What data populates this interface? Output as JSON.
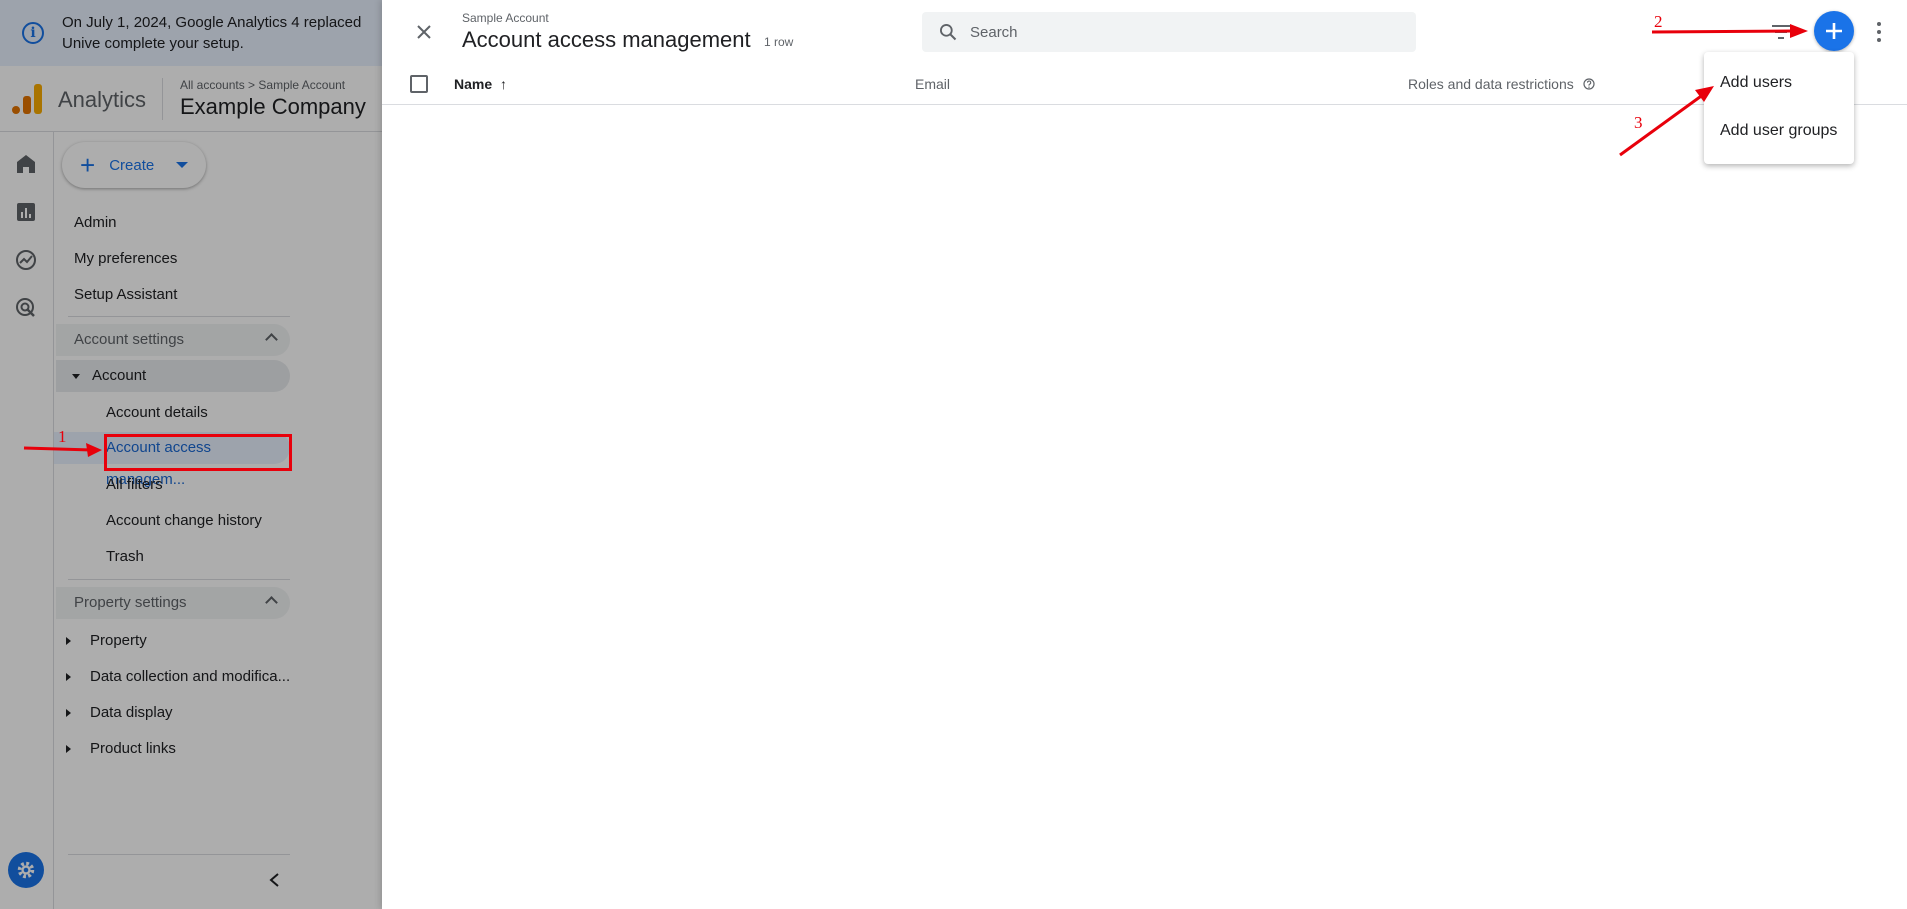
{
  "banner": {
    "text": "On July 1, 2024, Google Analytics 4 replaced Unive complete your setup."
  },
  "header": {
    "brand": "Analytics",
    "breadcrumb_root": "All accounts",
    "breadcrumb_separator": ">",
    "breadcrumb_account": "Sample Account",
    "account_name": "Example Company"
  },
  "sidebar": {
    "create_label": "Create",
    "items": {
      "admin": "Admin",
      "preferences": "My preferences",
      "setup": "Setup Assistant"
    },
    "account_settings": {
      "header": "Account settings",
      "group": "Account",
      "children": {
        "details": "Account details",
        "access": "Account access managem...",
        "filters": "All filters",
        "history": "Account change history",
        "trash": "Trash"
      }
    },
    "property_settings": {
      "header": "Property settings",
      "items": {
        "property": "Property",
        "data_collection": "Data collection and modifica...",
        "data_display": "Data display",
        "product_links": "Product links"
      }
    }
  },
  "sheet": {
    "eyebrow": "Sample Account",
    "title": "Account access management",
    "row_count": "1 row",
    "search_placeholder": "Search",
    "columns": {
      "name": "Name",
      "name_sort": "↑",
      "email": "Email",
      "roles": "Roles and data restrictions"
    }
  },
  "add_menu": {
    "add_users": "Add users",
    "add_user_groups": "Add user groups"
  },
  "annotations": {
    "step1": "1",
    "step2": "2",
    "step3": "3"
  },
  "colors": {
    "accent": "#1a73e8",
    "annotation": "#e8000b",
    "logo_dark": "#e37400",
    "logo_light": "#f9ab00"
  }
}
